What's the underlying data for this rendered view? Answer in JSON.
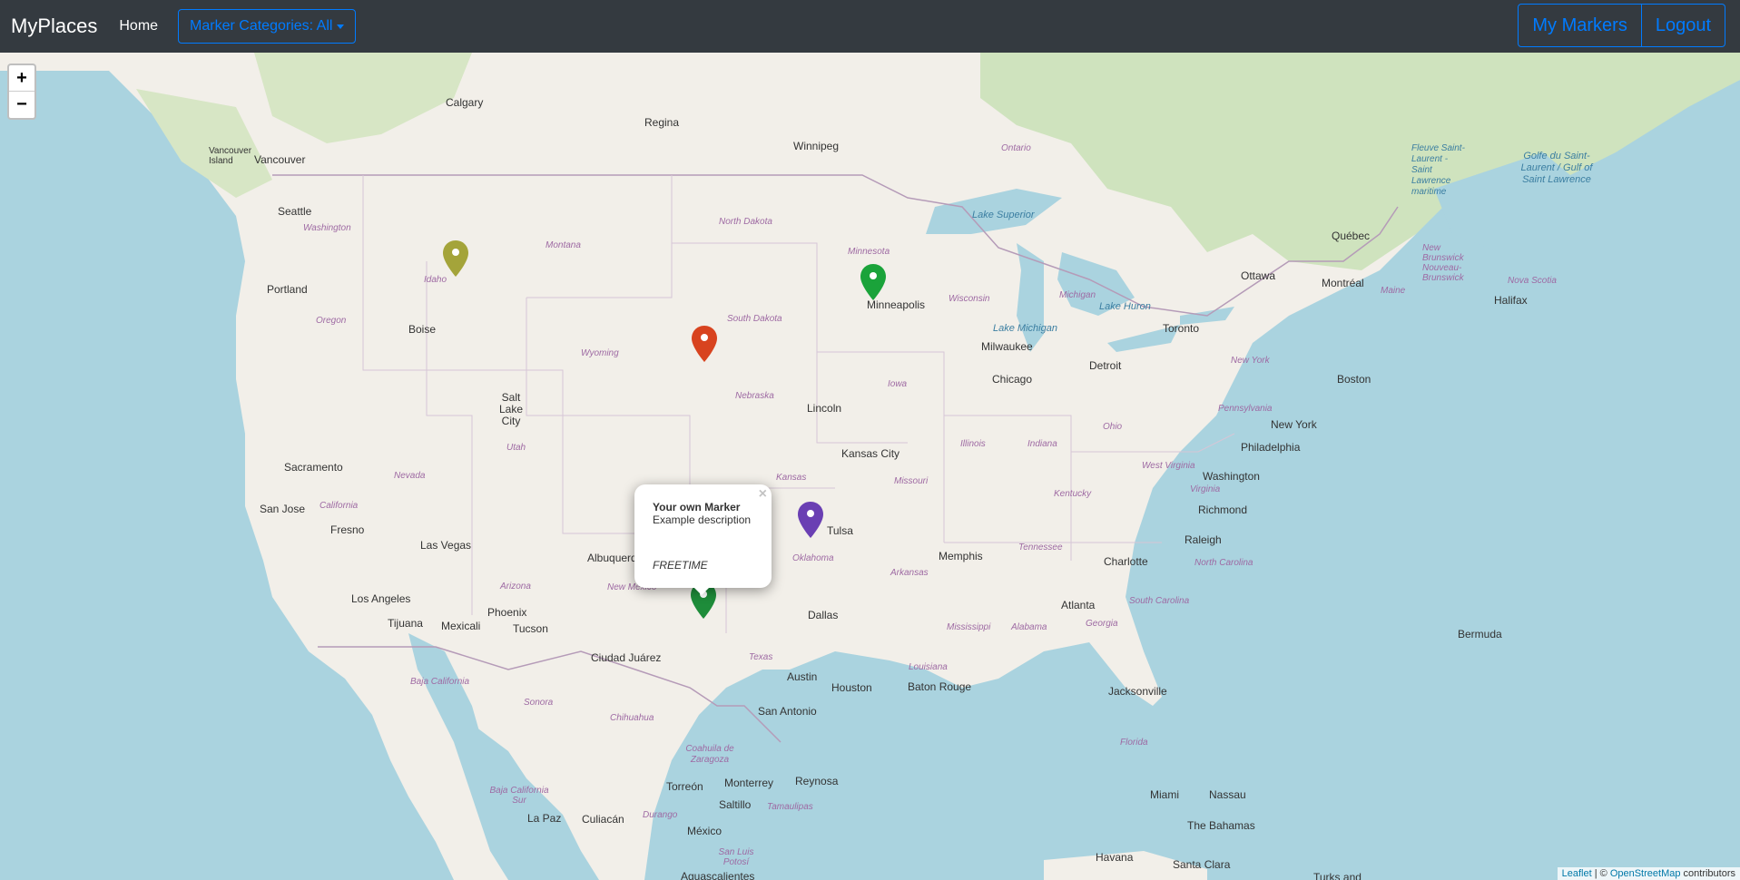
{
  "navbar": {
    "brand": "MyPlaces",
    "home": "Home",
    "categories": "Marker Categories: All",
    "my_markers": "My Markers",
    "logout": "Logout"
  },
  "map": {
    "zoom_in": "+",
    "zoom_out": "−",
    "cities": [
      "Calgary",
      "Regina",
      "Winnipeg",
      "Vancouver Island",
      "Vancouver",
      "Seattle",
      "Portland",
      "Boise",
      "Salt Lake City",
      "Sacramento",
      "San Jose",
      "Fresno",
      "Las Vegas",
      "Los Angeles",
      "Tijuana",
      "Mexicali",
      "Phoenix",
      "Tucson",
      "Albuquerque",
      "Ciudad Juárez",
      "Minneapolis",
      "Milwaukee",
      "Chicago",
      "Detroit",
      "Toronto",
      "Ottawa",
      "Montréal",
      "Québec",
      "Halifax",
      "Boston",
      "New York",
      "Philadelphia",
      "Washington",
      "Richmond",
      "Raleigh",
      "Charlotte",
      "Atlanta",
      "Jacksonville",
      "Miami",
      "Nassau",
      "Havana",
      "Santa Clara",
      "Lincoln",
      "Kansas City",
      "Tulsa",
      "Dallas",
      "Austin",
      "San Antonio",
      "Houston",
      "Baton Rouge",
      "Memphis",
      "Monterrey",
      "Reynosa",
      "Torreón",
      "Saltillo",
      "Culiacán",
      "La Paz",
      "México",
      "Aguascalientes",
      "Bermuda",
      "The Bahamas",
      "Turks and"
    ],
    "states": [
      "Washington",
      "Oregon",
      "Idaho",
      "Montana",
      "Wyoming",
      "Nevada",
      "California",
      "Utah",
      "Arizona",
      "New Mexico",
      "North Dakota",
      "South Dakota",
      "Nebraska",
      "Kansas",
      "Oklahoma",
      "Texas",
      "Minnesota",
      "Iowa",
      "Missouri",
      "Arkansas",
      "Louisiana",
      "Mississippi",
      "Alabama",
      "Georgia",
      "Florida",
      "Tennessee",
      "Kentucky",
      "Illinois",
      "Indiana",
      "Ohio",
      "Michigan",
      "Wisconsin",
      "Pennsylvania",
      "New York",
      "West Virginia",
      "Virginia",
      "North Carolina",
      "South Carolina",
      "Ontario",
      "Maine",
      "New Brunswick Nouveau-Brunswick",
      "Nova Scotia",
      "Baja California",
      "Sonora",
      "Chihuahua",
      "Coahuila de Zaragoza",
      "Durango",
      "Tamaulipas",
      "Baja California Sur",
      "San Luis Potosí"
    ],
    "waters": [
      "Lake Superior",
      "Lake Michigan",
      "Lake Huron",
      "Fleuve Saint-Laurent - Saint Lawrence maritime",
      "Golfe du Saint-Laurent / Gulf of Saint Lawrence"
    ],
    "markers": [
      {
        "name": "idaho-marker",
        "color": "#a4a43a"
      },
      {
        "name": "minneapolis-marker",
        "color": "#1aa33a"
      },
      {
        "name": "south-dakota-marker",
        "color": "#d8431f"
      },
      {
        "name": "oklahoma-marker",
        "color": "#6a3fb3"
      },
      {
        "name": "new-mexico-marker",
        "color": "#1e8c3a"
      }
    ],
    "popup": {
      "title": "Your own Marker",
      "description": "Example description",
      "category": "FREETIME",
      "close": "×"
    },
    "attribution": {
      "leaflet": "Leaflet",
      "sep": " | © ",
      "osm": "OpenStreetMap",
      "contrib": " contributors"
    }
  }
}
